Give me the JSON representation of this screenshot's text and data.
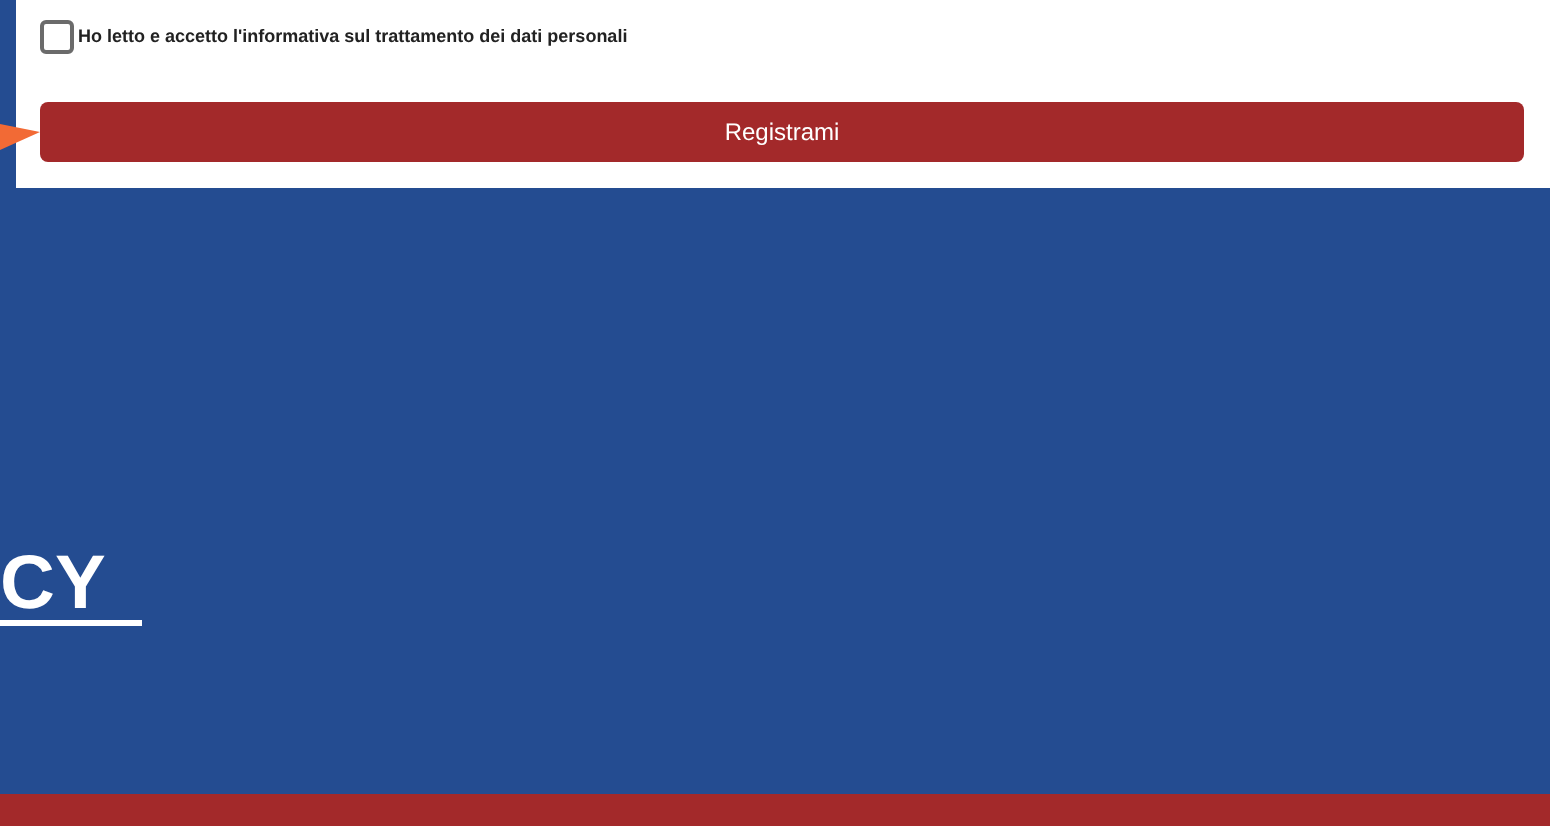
{
  "consent": {
    "label": "Ho letto e accetto l'informativa sul trattamento dei dati personali",
    "checked": false
  },
  "submit_button": "Registrami",
  "heading": "CY"
}
